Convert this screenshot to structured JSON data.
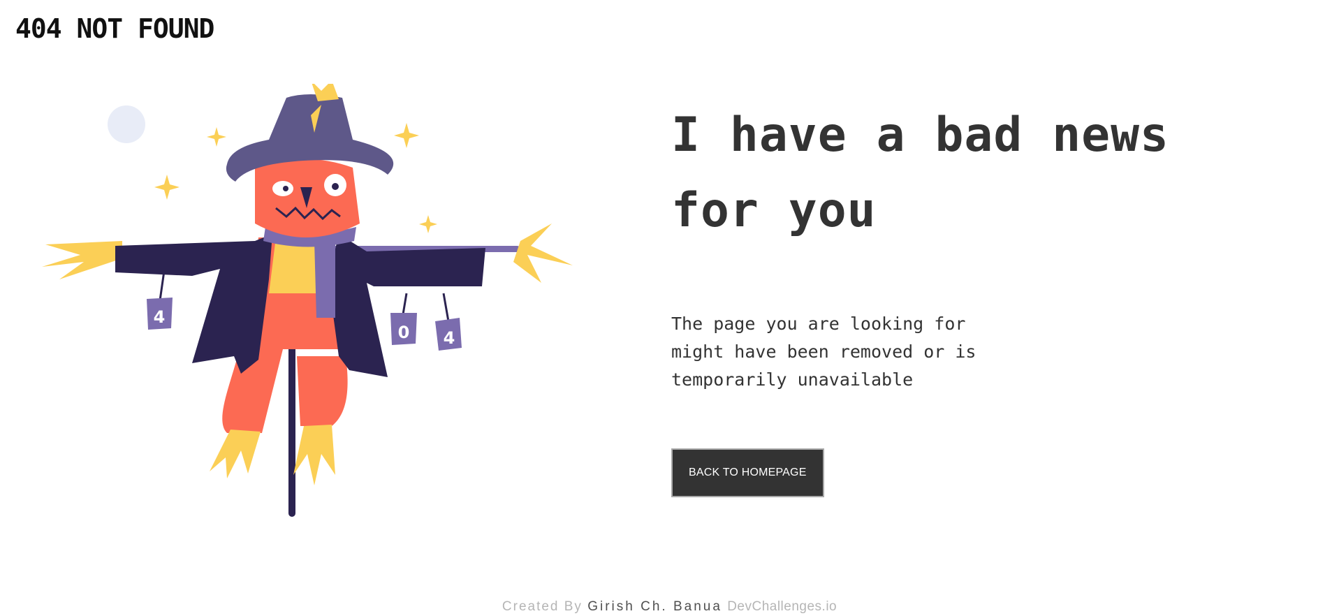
{
  "header": {
    "brand": "404 NOT FOUND"
  },
  "main": {
    "headline_line1": "I have a bad news",
    "headline_line2": "for you",
    "message_line1": "The page you are looking for",
    "message_line2": "might have been removed or is",
    "message_line3": "temporarily unavailable",
    "button_label": "BACK TO HOMEPAGE"
  },
  "illustration": {
    "icon": "scarecrow-illustration",
    "can_labels": [
      "4",
      "0",
      "4"
    ],
    "colors": {
      "hat": "#5E5889",
      "coat": "#2B2350",
      "face": "#FC6A53",
      "straw": "#FBCF56",
      "scarf": "#7B6CAE",
      "moon": "#E8ECF7"
    }
  },
  "footer": {
    "prefix": "Created By",
    "author": "Girish Ch. Banua",
    "site": "DevChallenges.io"
  },
  "colors": {
    "text": "#333333",
    "button_bg": "#333333",
    "button_text": "#FFFFFF",
    "footer_muted": "#B5B5B5"
  }
}
